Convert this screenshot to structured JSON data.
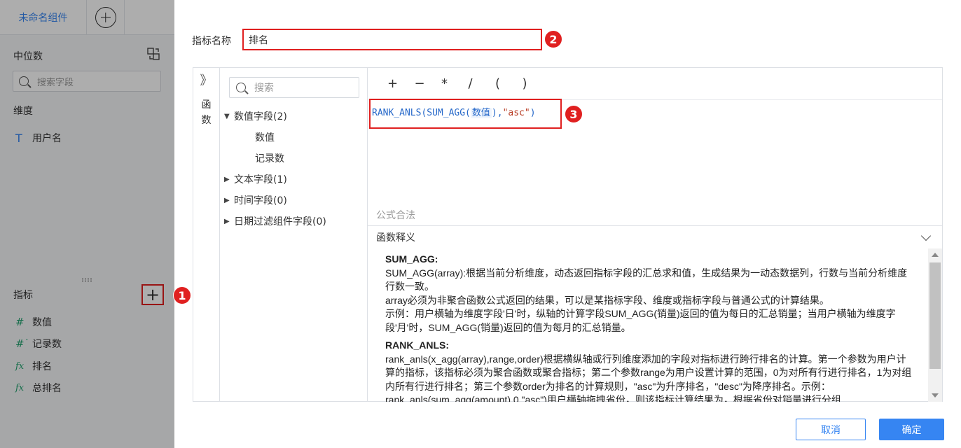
{
  "left": {
    "tab_label": "未命名组件",
    "median_title": "中位数",
    "search_placeholder": "搜索字段",
    "dimension_title": "维度",
    "dimensions": [
      {
        "icon": "text-type-icon",
        "glyph": "T",
        "label": "用户名"
      }
    ],
    "metric_title": "指标",
    "metrics": [
      {
        "icon": "number-field-icon",
        "glyph": "#",
        "label": "数值"
      },
      {
        "icon": "count-field-icon",
        "glyph": "#˙",
        "label": "记录数"
      },
      {
        "icon": "formula-fx-icon",
        "glyph": "fx",
        "label": "排名"
      },
      {
        "icon": "formula-fx-icon",
        "glyph": "fx",
        "label": "总排名"
      }
    ],
    "badge": "1"
  },
  "dialog": {
    "name_label": "指标名称",
    "name_value": "排名",
    "badge2": "2",
    "fn_toggle": "》",
    "fn_vertical_label": "函数",
    "tree_search_placeholder": "搜索",
    "tree": {
      "numeric": "数值字段(2)",
      "numeric_children": [
        "数值",
        "记录数"
      ],
      "text": "文本字段(1)",
      "time": "时间字段(0)",
      "date_filter": "日期过滤组件字段(0)"
    },
    "operators": [
      "+",
      "−",
      "*",
      "/",
      "(",
      ")"
    ],
    "formula": {
      "prefix": "RANK_ANLS(SUM_AGG(",
      "field": "数值",
      "middle": "),",
      "string": "\"asc\"",
      "suffix": ")"
    },
    "badge3": "3",
    "valid_text": "公式合法",
    "explain_title": "函数释义",
    "explain": {
      "sum_title": "SUM_AGG:",
      "sum_l1": "SUM_AGG(array):根据当前分析维度，动态返回指标字段的汇总求和值，生成结果为一动态数据列，行数与当前分析维度行数一致。",
      "sum_l2": " array必须为非聚合函数公式返回的结果，可以是某指标字段、维度或指标字段与普通公式的计算结果。",
      "sum_l3": " 示例：用户横轴为维度字段'日'时，纵轴的计算字段SUM_AGG(销量)返回的值为每日的汇总销量；当用户横轴为维度字段'月'时，SUM_AGG(销量)返回的值为每月的汇总销量。",
      "rank_title": "RANK_ANLS:",
      "rank_l1": "rank_anls(x_agg(array),range,order)根据横纵轴或行列维度添加的字段对指标进行跨行排名的计算。第一个参数为用户计算的指标，该指标必须为聚合函数或聚合指标；第二个参数range为用户设置计算的范围，0为对所有行进行排名，1为对组内所有行进行排名；第三个参数order为排名的计算规则，\"asc\"为升序排名，\"desc\"为降序排名。示例：rank_anls(sum_agg(amount),0,\"asc\")用户横轴拖拽省份，则该指标计算结果为，根据省份对销量进行分组"
    },
    "cancel_label": "取消",
    "ok_label": "确定"
  }
}
